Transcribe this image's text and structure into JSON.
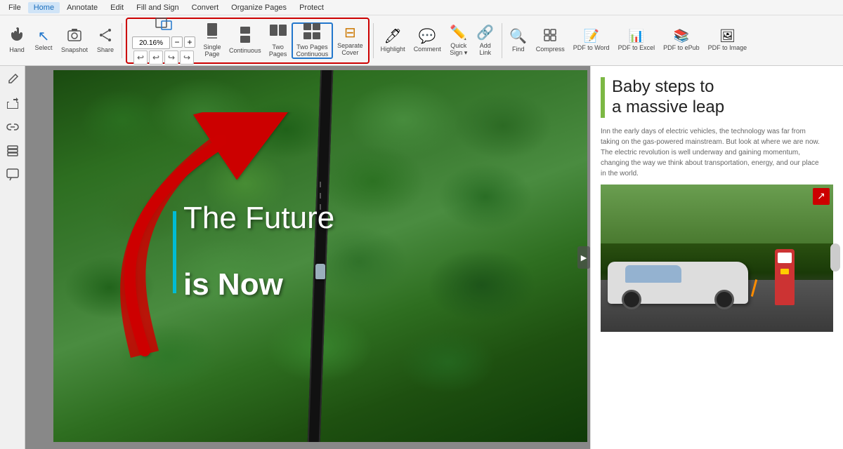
{
  "menubar": {
    "items": [
      "File",
      "Home",
      "Annotate",
      "Edit",
      "Fill and Sign",
      "Convert",
      "Organize Pages",
      "Protect"
    ],
    "active": "Home"
  },
  "toolbar": {
    "tools": [
      {
        "id": "hand",
        "label": "Hand",
        "icon": "✋"
      },
      {
        "id": "select",
        "label": "Select",
        "icon": "↖"
      },
      {
        "id": "snapshot",
        "label": "Snapshot",
        "icon": "📷"
      },
      {
        "id": "share",
        "label": "Share",
        "icon": "↗"
      }
    ],
    "zoom": {
      "value": "20.16%",
      "actual_size_label": "Actual\nSize",
      "minus_label": "−",
      "plus_label": "+"
    },
    "view_modes": [
      {
        "id": "single-page",
        "label": "Single\nPage",
        "icon": "📄"
      },
      {
        "id": "continuous",
        "label": "Continuous",
        "icon": "📄"
      },
      {
        "id": "two-pages",
        "label": "Two\nPages",
        "icon": "📄"
      },
      {
        "id": "two-pages-continuous",
        "label": "Two Pages\nContinuous",
        "icon": "📄"
      },
      {
        "id": "separate-cover",
        "label": "Separate\nCover",
        "icon": "📄"
      }
    ],
    "review_tools": [
      {
        "id": "highlight",
        "label": "Highlight",
        "icon": "🖊"
      },
      {
        "id": "comment",
        "label": "Comment",
        "icon": "💬"
      },
      {
        "id": "quick-sign",
        "label": "Quick\nSign",
        "icon": "✏️"
      },
      {
        "id": "add-link",
        "label": "Add\nLink",
        "icon": "🔗"
      }
    ],
    "right_tools": [
      {
        "id": "find",
        "label": "Find",
        "icon": "🔍"
      },
      {
        "id": "compress",
        "label": "Compress",
        "icon": "🗜"
      },
      {
        "id": "pdf-to-word",
        "label": "PDF to Word",
        "icon": "📝"
      },
      {
        "id": "pdf-to-excel",
        "label": "PDF to Excel",
        "icon": "📊"
      },
      {
        "id": "pdf-to-epub",
        "label": "PDF to ePub",
        "icon": "📚"
      },
      {
        "id": "pdf-to-image",
        "label": "PDF to Image",
        "icon": "🖼"
      }
    ]
  },
  "sidebar": {
    "tools": [
      {
        "id": "edit-tool",
        "icon": "✏️"
      },
      {
        "id": "share-tool",
        "icon": "↗"
      },
      {
        "id": "link-tool",
        "icon": "🔗"
      },
      {
        "id": "layers-tool",
        "icon": "⊞"
      },
      {
        "id": "comment-tool",
        "icon": "📌"
      }
    ]
  },
  "pdf": {
    "headline_line1": "The Future",
    "headline_line2": "is Now",
    "page_title_line1": "Baby steps to",
    "page_title_line2": "a massive leap",
    "side_text_line1": "In",
    "side_text_line2": "ta",
    "side_text_line3": "T",
    "side_text_line4": "c",
    "side_text_line5": "in"
  }
}
